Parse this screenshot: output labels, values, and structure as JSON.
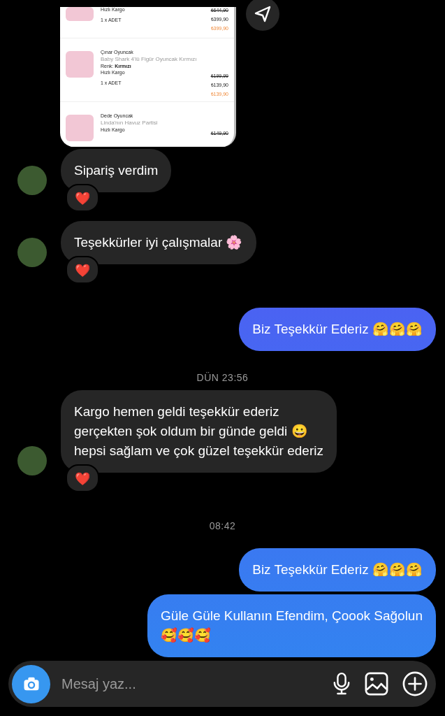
{
  "shared_order": {
    "items": [
      {
        "shipping": "Hızlı Kargo",
        "quantity": "1 x ADET",
        "old_price": "₺644,90",
        "price": "₺399,90",
        "total": "₺399,90"
      },
      {
        "store": "Çınar Oyuncak",
        "description": "Baby Shark 4'lü Figür Oyuncak Kırmızı",
        "color_label": "Renk: **Kırmızı**",
        "shipping": "Hızlı Kargo",
        "quantity": "1 x ADET",
        "old_price": "₺199,99",
        "price": "₺139,90",
        "total": "₺139,90"
      },
      {
        "store": "Dede Oyuncak",
        "description": "Linda'nın Havuz Partisi",
        "shipping": "Hızlı Kargo",
        "old_price": "₺149,90"
      }
    ]
  },
  "messages": [
    {
      "kind": "incoming",
      "lines": [
        "Sipariş verdim"
      ],
      "reaction": "❤️"
    },
    {
      "kind": "incoming",
      "lines": [
        "Teşekkürler iyi çalışmalar 🌸"
      ],
      "reaction": "❤️"
    },
    {
      "kind": "outgoing",
      "lines": [
        "Biz Teşekkür Ederiz 🤗🤗🤗"
      ]
    },
    {
      "kind": "timestamp",
      "lines": [
        "DÜN 23:56"
      ]
    },
    {
      "kind": "incoming",
      "lines": [
        "Kargo hemen geldi teşekkür ederiz",
        "gerçekten şok oldum bir günde geldi 😀",
        "hepsi sağlam ve çok güzel teşekkür ederiz"
      ],
      "reaction": "❤️"
    },
    {
      "kind": "timestamp",
      "lines": [
        "08:42"
      ]
    },
    {
      "kind": "outgoing",
      "lines": [
        "Biz Teşekkür Ederiz 🤗🤗🤗"
      ]
    },
    {
      "kind": "outgoing",
      "lines": [
        "Güle Güle Kullanın Efendim, Çoook Sağolun",
        "🥰🥰🥰"
      ]
    }
  ],
  "composer": {
    "placeholder": "Mesaj yaz..."
  }
}
